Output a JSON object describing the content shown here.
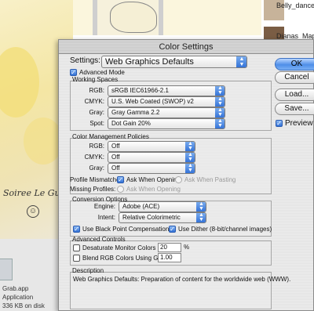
{
  "background": {
    "signature": "Soiree Le Guide",
    "file_info": [
      "Grab.app",
      "Application",
      "336 KB on disk"
    ],
    "thumbnails": [
      "Belly_dancer",
      "Dianas_Map"
    ]
  },
  "dialog": {
    "title": "Color Settings",
    "settings_label": "Settings:",
    "settings_value": "Web Graphics Defaults",
    "advanced_mode": "Advanced Mode",
    "working_spaces": {
      "title": "Working Spaces",
      "rows": [
        {
          "label": "RGB:",
          "value": "sRGB IEC61966-2.1"
        },
        {
          "label": "CMYK:",
          "value": "U.S. Web Coated (SWOP) v2"
        },
        {
          "label": "Gray:",
          "value": "Gray Gamma 2.2"
        },
        {
          "label": "Spot:",
          "value": "Dot Gain 20%"
        }
      ]
    },
    "color_management": {
      "title": "Color Management Policies",
      "rows": [
        {
          "label": "RGB:",
          "value": "Off"
        },
        {
          "label": "CMYK:",
          "value": "Off"
        },
        {
          "label": "Gray:",
          "value": "Off"
        }
      ],
      "profile_mismatches": "Profile Mismatches:",
      "ask_when_opening": "Ask When Opening",
      "ask_when_pasting": "Ask When Pasting",
      "missing_profiles": "Missing Profiles:",
      "ask_when_opening_2": "Ask When Opening"
    },
    "conversion": {
      "title": "Conversion Options",
      "engine_label": "Engine:",
      "engine_value": "Adobe (ACE)",
      "intent_label": "Intent:",
      "intent_value": "Relative Colorimetric",
      "black_point": "Use Black Point Compensation",
      "dither": "Use Dither (8-bit/channel images)"
    },
    "advanced_controls": {
      "title": "Advanced Controls",
      "desaturate": "Desaturate Monitor Colors By:",
      "desaturate_value": "20",
      "percent": "%",
      "blend": "Blend RGB Colors Using Gamma:",
      "blend_value": "1.00"
    },
    "description": {
      "title": "Description",
      "text": "Web Graphics Defaults:  Preparation of content for the worldwide web (WWW)."
    },
    "buttons": {
      "ok": "OK",
      "cancel": "Cancel",
      "load": "Load...",
      "save": "Save..."
    },
    "preview": "Preview"
  }
}
